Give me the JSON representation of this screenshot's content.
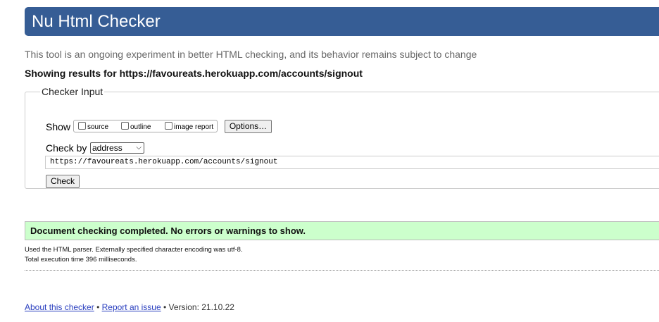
{
  "header": {
    "title": "Nu Html Checker"
  },
  "intro_text": "This tool is an ongoing experiment in better HTML checking, and its behavior remains subject to change",
  "showing_results": "Showing results for https://favoureats.herokuapp.com/accounts/signout",
  "checker_input": {
    "legend": "Checker Input",
    "show_label": "Show",
    "show_options": [
      "source",
      "outline",
      "image report"
    ],
    "options_button": "Options…",
    "check_by_label": "Check by",
    "check_by_value": "address",
    "url_value": "https://favoureats.herokuapp.com/accounts/signout",
    "check_button": "Check"
  },
  "result": {
    "status": "Document checking completed. No errors or warnings to show.",
    "parser_note": "Used the HTML parser. Externally specified character encoding was utf-8.",
    "execution_time": "Total execution time 396 milliseconds."
  },
  "footer": {
    "about_link": "About this checker",
    "separator": "•",
    "report_link": "Report an issue",
    "version": "Version: 21.10.22"
  },
  "colors": {
    "header_bg": "#365d95",
    "success_bg": "#ccffcc"
  }
}
